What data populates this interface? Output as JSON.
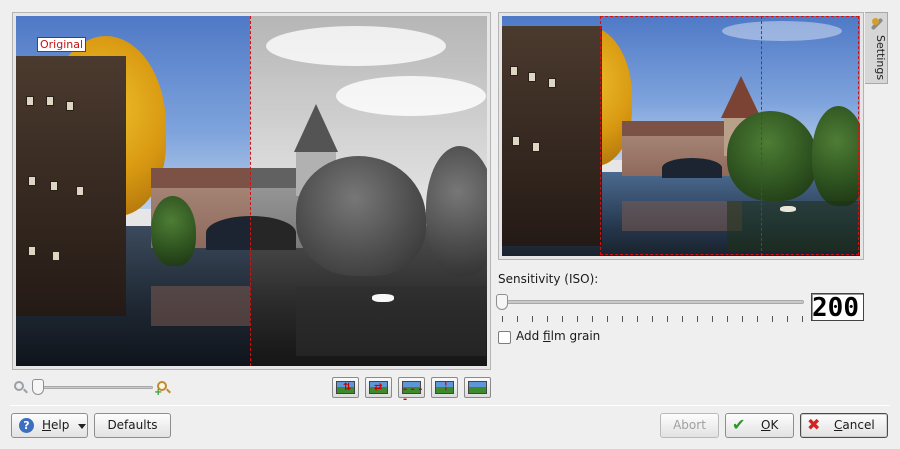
{
  "preview": {
    "original_label": "Original"
  },
  "zoom": {
    "zoom_out_icon": "zoom-out-icon",
    "zoom_in_icon": "zoom-in-icon",
    "level": 0.03
  },
  "preview_modes": [
    {
      "name": "separate-vertical-icon"
    },
    {
      "name": "separate-horizontal-icon"
    },
    {
      "name": "split-vertical-duplicate-icon"
    },
    {
      "name": "split-vertical-icon"
    },
    {
      "name": "no-split-icon"
    }
  ],
  "settings_tab": {
    "label": "Settings",
    "icon": "wrench-icon"
  },
  "sensitivity": {
    "label": "Sensitivity (ISO):",
    "value": "200",
    "slider_fraction": 0.0
  },
  "film_grain": {
    "label_pre": "Add ",
    "label_accel": "f",
    "label_post": "ilm grain",
    "checked": false
  },
  "buttons": {
    "help": {
      "pre": "",
      "accel": "H",
      "post": "elp"
    },
    "defaults": {
      "label": "Defaults"
    },
    "abort": {
      "label": "Abort"
    },
    "ok": {
      "pre": "",
      "accel": "O",
      "post": "K"
    },
    "cancel": {
      "pre": "",
      "accel": "C",
      "post": "ancel"
    }
  },
  "colors": {
    "accent": "#3a6fc2",
    "selection_red": "#d21010",
    "ok_green": "#2a9a2a",
    "cancel_red": "#d32424"
  }
}
